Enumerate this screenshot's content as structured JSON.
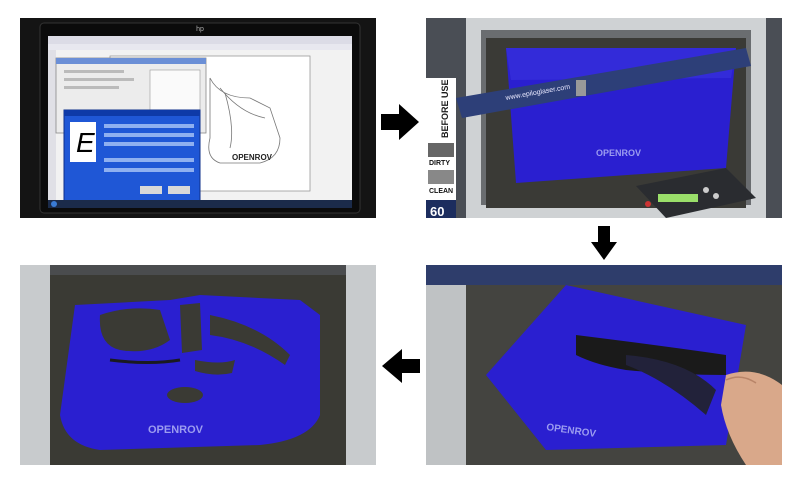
{
  "panels": {
    "screen": {
      "monitor_brand": "hp",
      "dialog_big_letter": "E",
      "logo_text": "OPENROV"
    },
    "engraver": {
      "url_text": "www.epiloglaser.com",
      "before_use_label": "BEFORE USE",
      "dirty_label": "DIRTY",
      "clean_label": "CLEAN",
      "number_label": "60",
      "logo_text": "OPENROV"
    },
    "removing": {
      "logo_text": "OPENROV"
    },
    "finished": {
      "logo_text": "OPENROV"
    }
  },
  "colors": {
    "acrylic_blue": "#2a1fd0",
    "arrow": "#000000"
  },
  "icons": [
    "arrow-right-icon",
    "arrow-down-icon",
    "arrow-left-icon"
  ]
}
